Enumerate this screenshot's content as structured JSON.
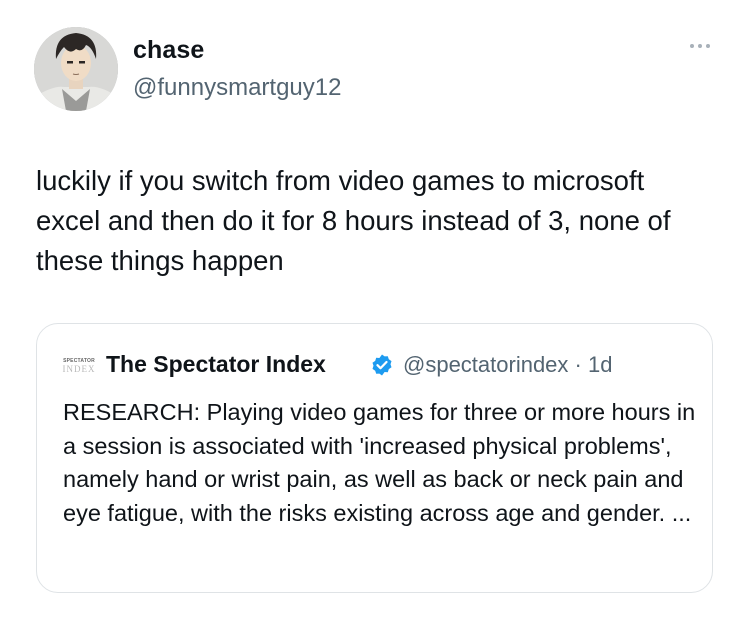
{
  "post": {
    "author_name": "chase",
    "author_handle": "@funnysmartguy12",
    "text": "luckily if you switch from video games to microsoft excel and then do it for 8 hours instead of 3, none of these things happen"
  },
  "quote": {
    "avatar_line1": "SPECTATOR",
    "avatar_line2": "INDEX",
    "author_name": "The Spectator Index",
    "handle_time": "@spectatorindex · 1d",
    "text": "RESEARCH: Playing video games for three or more hours in a session is associated with 'increased physical problems', namely hand or wrist pain, as well as back or neck pain and eye fatigue, with the risks existing across age and gender. ..."
  },
  "icons": {
    "more": "more-options-icon",
    "verified": "verified-badge-icon"
  },
  "colors": {
    "text": "#0f1419",
    "secondary": "#536471",
    "verified": "#1d9bf0",
    "border": "#dfe3e6"
  }
}
